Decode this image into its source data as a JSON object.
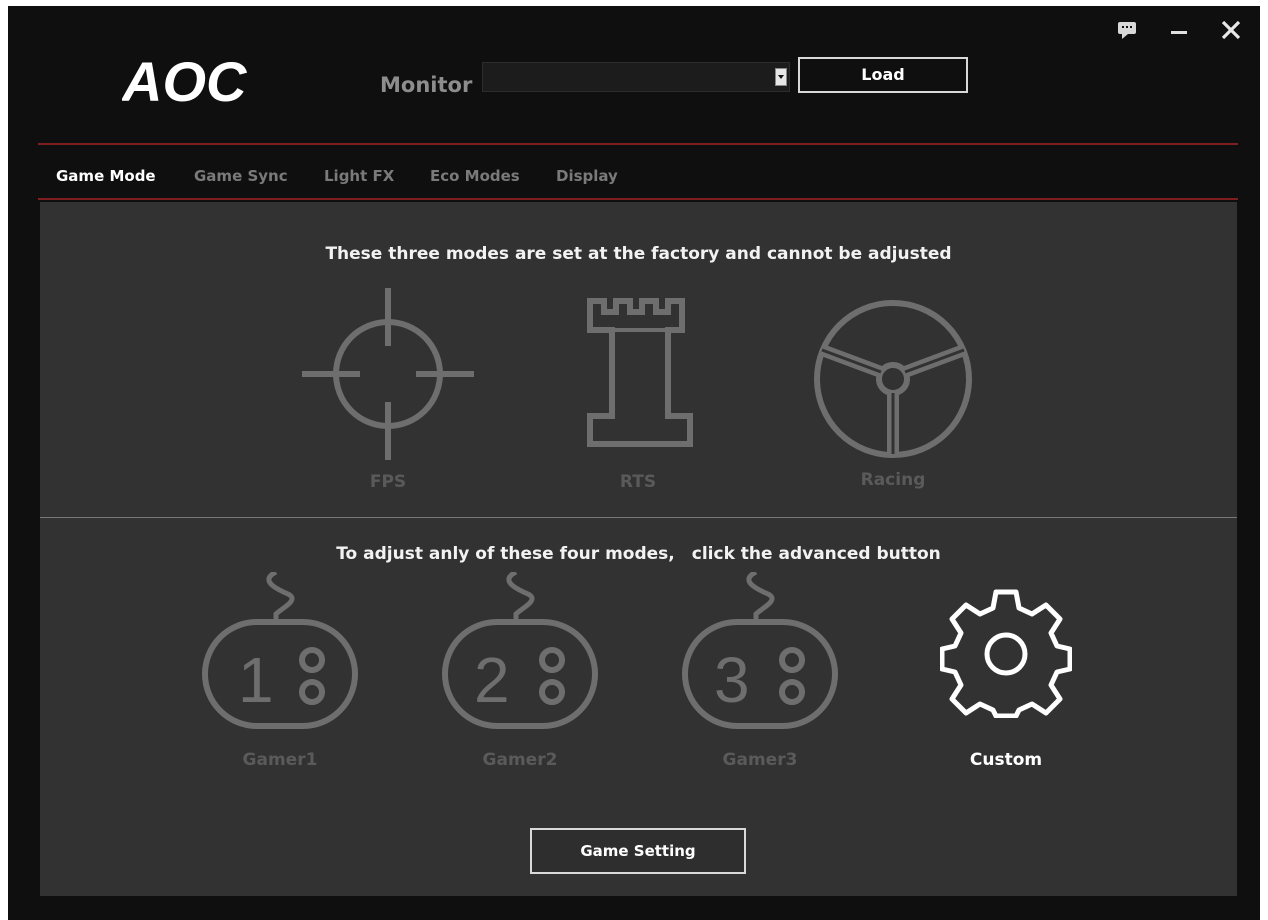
{
  "header": {
    "logo_text": "AOC",
    "monitor_label": "Monitor",
    "monitor_value": "",
    "load_label": "Load"
  },
  "window_controls": [
    {
      "icon": "feedback-icon"
    },
    {
      "icon": "minimize-icon"
    },
    {
      "icon": "close-icon"
    }
  ],
  "tabs": [
    {
      "label": "Game Mode",
      "active": true
    },
    {
      "label": "Game Sync",
      "active": false
    },
    {
      "label": "Light FX",
      "active": false
    },
    {
      "label": "Eco Modes",
      "active": false
    },
    {
      "label": "Display",
      "active": false
    }
  ],
  "factory_section": {
    "heading": "These three modes are set at the factory and cannot be adjusted",
    "modes": [
      {
        "label": "FPS",
        "icon": "crosshair-icon"
      },
      {
        "label": "RTS",
        "icon": "rook-tower-icon"
      },
      {
        "label": "Racing",
        "icon": "steering-wheel-icon"
      }
    ]
  },
  "adjustable_section": {
    "heading": "To adjust anly of these four modes,　click the advanced button",
    "modes": [
      {
        "label": "Gamer1",
        "icon": "gamepad-1-icon",
        "number": "1"
      },
      {
        "label": "Gamer2",
        "icon": "gamepad-2-icon",
        "number": "2"
      },
      {
        "label": "Gamer3",
        "icon": "gamepad-3-icon",
        "number": "3"
      },
      {
        "label": "Custom",
        "icon": "gear-icon"
      }
    ]
  },
  "game_setting_label": "Game Setting",
  "colors": {
    "panel_bg": "#323232",
    "app_bg": "#0f0f0f",
    "accent_red": "#7e1e1e",
    "icon_gray": "#6e6e6e",
    "active_white": "#ffffff"
  }
}
